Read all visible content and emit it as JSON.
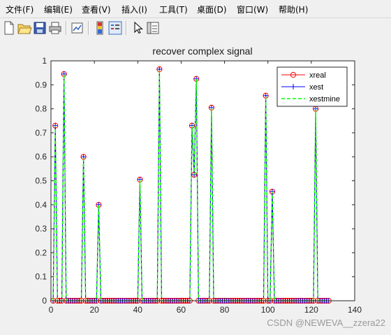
{
  "menu": [
    "文件(F)",
    "编辑(E)",
    "查看(V)",
    "插入(I)",
    "工具(T)",
    "桌面(D)",
    "窗口(W)",
    "帮助(H)"
  ],
  "toolbar": {
    "icons": [
      "new-file-icon",
      "open-folder-icon",
      "save-icon",
      "print-icon",
      "link-plot-icon",
      "colorbar-icon",
      "legend-icon",
      "pointer-icon",
      "property-editor-icon"
    ]
  },
  "watermark": "CSDN @NEWEVA__zzera22",
  "chart_data": {
    "type": "line",
    "title": "recover  complex signal",
    "xlabel": "",
    "ylabel": "",
    "xlim": [
      0,
      140
    ],
    "ylim": [
      0,
      1
    ],
    "xticks": [
      0,
      20,
      40,
      60,
      80,
      100,
      120,
      140
    ],
    "yticks": [
      0,
      0.1,
      0.2,
      0.3,
      0.4,
      0.5,
      0.6,
      0.7,
      0.8,
      0.9,
      1
    ],
    "grid": false,
    "legend_position": "top-right",
    "n_points": 128,
    "spikes": [
      {
        "x": 2,
        "y": 0.73
      },
      {
        "x": 6,
        "y": 0.945
      },
      {
        "x": 15,
        "y": 0.6
      },
      {
        "x": 22,
        "y": 0.4
      },
      {
        "x": 41,
        "y": 0.505
      },
      {
        "x": 50,
        "y": 0.965
      },
      {
        "x": 65,
        "y": 0.73
      },
      {
        "x": 66,
        "y": 0.525
      },
      {
        "x": 67,
        "y": 0.925
      },
      {
        "x": 74,
        "y": 0.805
      },
      {
        "x": 99,
        "y": 0.855
      },
      {
        "x": 102,
        "y": 0.455
      },
      {
        "x": 122,
        "y": 0.8
      }
    ],
    "series": [
      {
        "name": "xreal",
        "color": "#ff0000",
        "marker": "circle",
        "line": "solid"
      },
      {
        "name": "xest",
        "color": "#0000ff",
        "marker": "plus",
        "line": "solid"
      },
      {
        "name": "xestmine",
        "color": "#00ff00",
        "marker": "none",
        "line": "dashed"
      }
    ]
  }
}
